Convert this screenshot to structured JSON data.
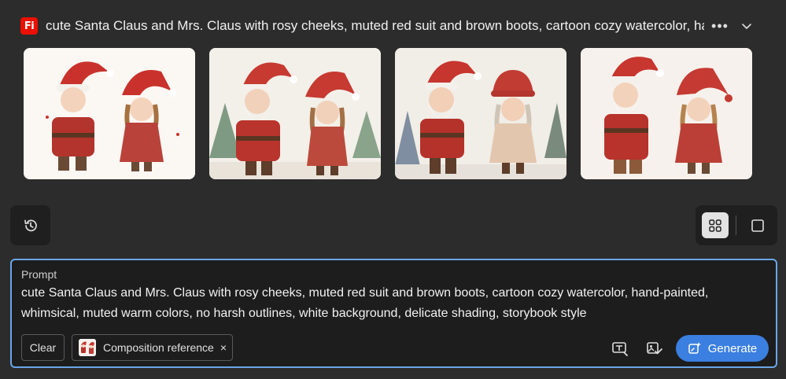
{
  "header": {
    "app_logo_text": "Fi",
    "title": "cute Santa Claus and Mrs. Claus with rosy cheeks, muted red suit and brown boots, cartoon cozy watercolor, hand-painted, whimsical, muted warm colors, no harsh outlines, white background, delicate shading, storybook style",
    "more_icon": "more-horizontal-icon",
    "expand_icon": "chevron-down-icon"
  },
  "results": {
    "images": [
      {
        "label": "Generated image 1"
      },
      {
        "label": "Generated image 2"
      },
      {
        "label": "Generated image 3"
      },
      {
        "label": "Generated image 4"
      }
    ]
  },
  "toolbar": {
    "history_icon": "history-icon",
    "grid_view_icon": "grid-view-icon",
    "single_view_icon": "single-view-icon"
  },
  "prompt": {
    "label": "Prompt",
    "text": "cute Santa Claus and Mrs. Claus with rosy cheeks, muted red suit and brown boots, cartoon cozy watercolor, hand-painted, whimsical, muted warm colors, no harsh outlines, white background, delicate shading, storybook style",
    "clear_label": "Clear",
    "composition_reference_label": "Composition reference",
    "composition_reference_close": "×",
    "generate_label": "Generate"
  },
  "colors": {
    "background": "#2c2c2c",
    "panel": "#1d1d1d",
    "accent": "#3b7fe0",
    "focus_border": "#6aa6e8",
    "brand": "#eb1000"
  }
}
